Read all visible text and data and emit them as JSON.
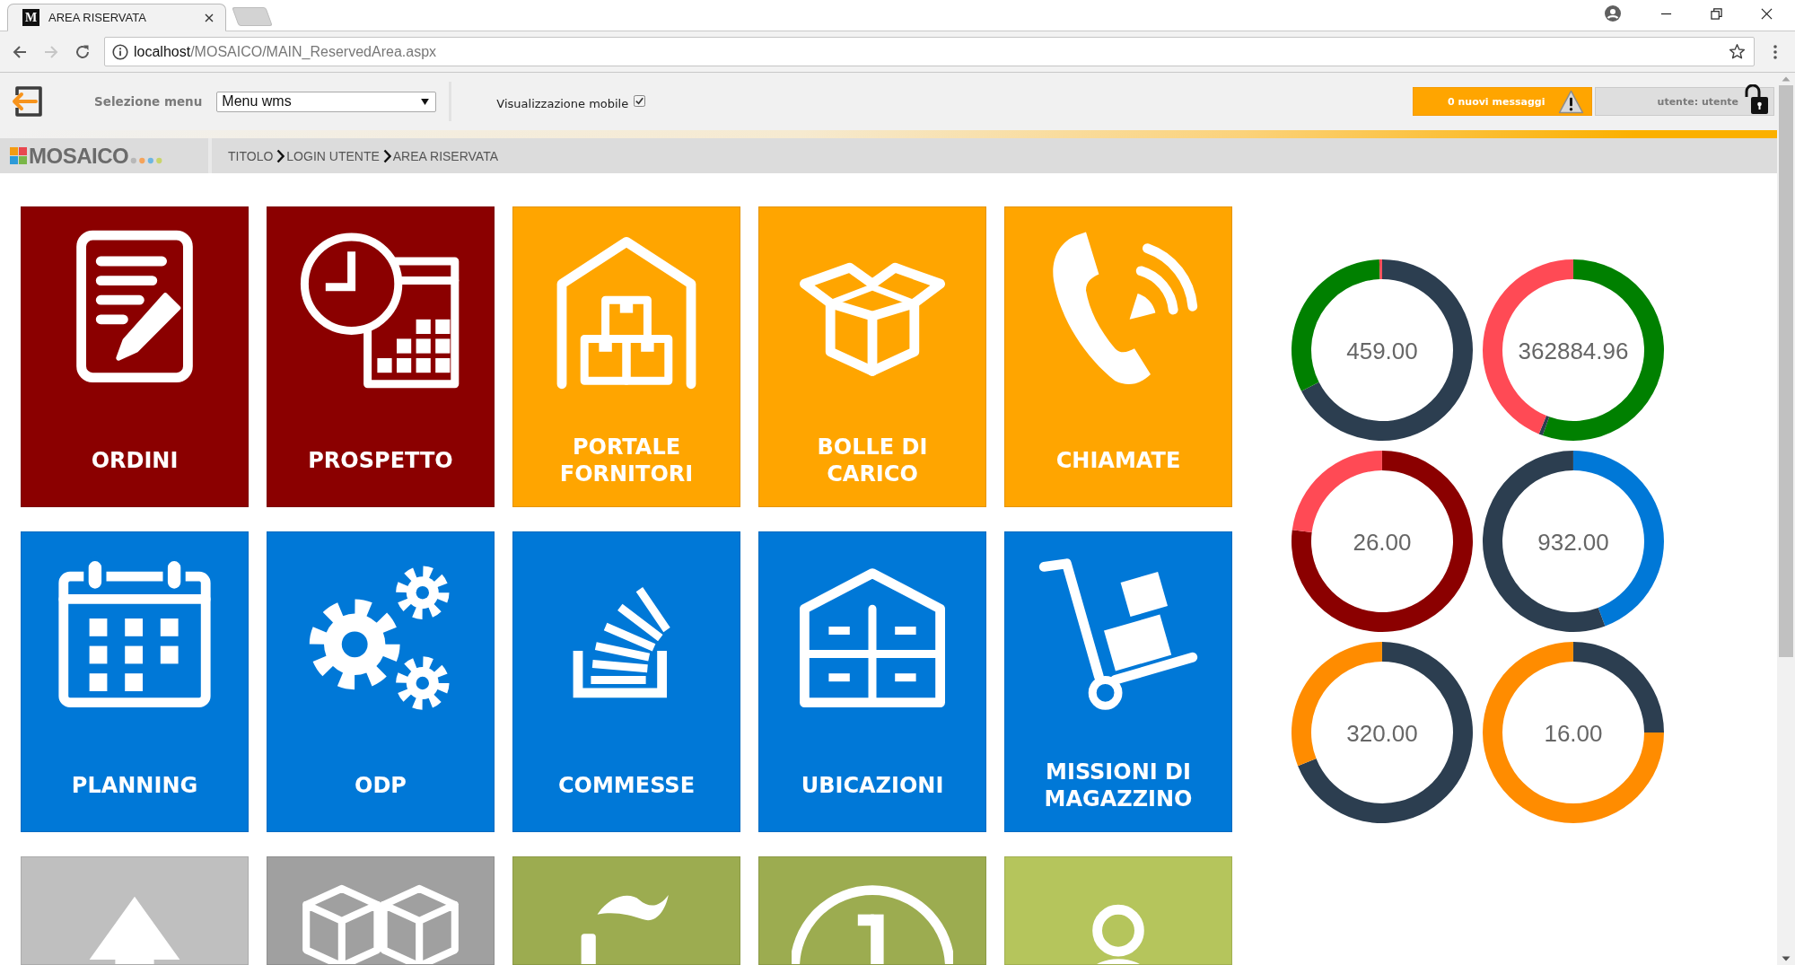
{
  "browser": {
    "tab": {
      "favicon": "M",
      "title": "AREA RISERVATA"
    },
    "forward_disabled": true,
    "url": {
      "host": "localhost",
      "path": "/MOSAICO/MAIN_ReservedArea.aspx"
    }
  },
  "toolbar": {
    "menu_label": "Selezione menu",
    "menu_value": "Menu wms",
    "mobile_label": "Visualizzazione mobile",
    "mobile_checked": true,
    "messages": "0 nuovi messaggi",
    "user": "utente: utente"
  },
  "brand": {
    "name": "MOSAICO"
  },
  "breadcrumb": [
    {
      "label": "TITOLO"
    },
    {
      "label": "LOGIN UTENTE"
    },
    {
      "label": "AREA RISERVATA"
    }
  ],
  "tiles": [
    {
      "label": "ORDINI",
      "color": "#8b0000"
    },
    {
      "label": "PROSPETTO",
      "color": "#8b0000"
    },
    {
      "label": "PORTALE FORNITORI",
      "color": "#ffa500"
    },
    {
      "label": "BOLLE DI CARICO",
      "color": "#ffa500"
    },
    {
      "label": "CHIAMATE",
      "color": "#ffa500"
    },
    {
      "label": "PLANNING",
      "color": "#0078d7"
    },
    {
      "label": "ODP",
      "color": "#0078d7"
    },
    {
      "label": "COMMESSE",
      "color": "#0078d7"
    },
    {
      "label": "UBICAZIONI",
      "color": "#0078d7"
    },
    {
      "label": "MISSIONI DI MAGAZZINO",
      "color": "#0078d7"
    },
    {
      "color": "#bfbfbf"
    },
    {
      "color": "#a0a0a0"
    },
    {
      "color": "#9cac50"
    },
    {
      "color": "#9cac50"
    },
    {
      "color": "#b5c55c"
    }
  ],
  "gauges": [
    {
      "value": "459.00"
    },
    {
      "value": "362884.96"
    },
    {
      "value": "26.00"
    },
    {
      "value": "932.00"
    },
    {
      "value": "320.00"
    },
    {
      "value": "16.00"
    }
  ]
}
